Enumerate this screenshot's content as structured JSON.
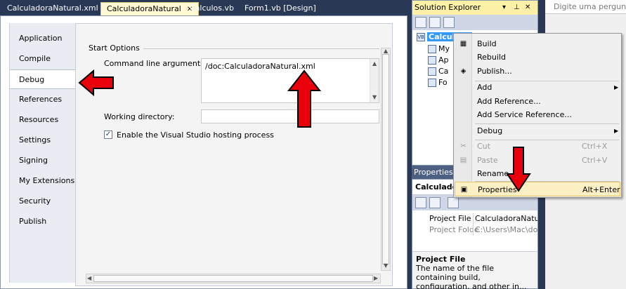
{
  "doc_tabs": [
    {
      "label": "CalculadoraNatural.xml",
      "active": false
    },
    {
      "label": "CalculadoraNatural",
      "active": true
    },
    {
      "label": "Calculos.vb",
      "active": false
    },
    {
      "label": "Form1.vb [Design]",
      "active": false
    }
  ],
  "close_glyph": "✕",
  "left_nav": {
    "items": [
      "Application",
      "Compile",
      "Debug",
      "References",
      "Resources",
      "Settings",
      "Signing",
      "My Extensions",
      "Security",
      "Publish"
    ],
    "selected": "Debug"
  },
  "start_options": {
    "section_title": "Start Options",
    "command_line_label": "Command line arguments:",
    "command_line_value": "/doc:CalculadoraNatural.xml",
    "working_dir_label": "Working directory:",
    "working_dir_value": "",
    "hosting_checkbox_label": "Enable the Visual Studio hosting process",
    "hosting_checked": true
  },
  "solution_explorer": {
    "title": "Solution Explorer",
    "pin_glyphs": [
      "▾",
      "⊥",
      "✕"
    ],
    "tree": [
      {
        "label": "Calculado",
        "icon": "vb-project-icon",
        "root": true
      },
      {
        "label": "My",
        "icon": "my-project-icon"
      },
      {
        "label": "Ap",
        "icon": "app-config-icon"
      },
      {
        "label": "Ca",
        "icon": "vb-file-icon"
      },
      {
        "label": "Fo",
        "icon": "form-file-icon"
      }
    ]
  },
  "properties": {
    "title": "Properties",
    "object": "Calculadora",
    "rows": [
      {
        "name": "Project File",
        "value": "CalculadoraNatural",
        "grey": false
      },
      {
        "name": "Project Folde",
        "value": "C:\\Users\\Mac\\doc",
        "grey": true
      }
    ],
    "desc_title": "Project File",
    "desc_text": "The name of the file containing build, configuration, and other in..."
  },
  "search": {
    "placeholder": "Digite uma pergunta"
  },
  "context_menu": {
    "items": [
      {
        "label": "Build",
        "shortcut": "",
        "icon": "build-icon",
        "submenu": false,
        "disabled": false,
        "highlight": false,
        "sep_before": false
      },
      {
        "label": "Rebuild",
        "shortcut": "",
        "icon": "",
        "submenu": false,
        "disabled": false,
        "highlight": false,
        "sep_before": false
      },
      {
        "label": "Publish...",
        "shortcut": "",
        "icon": "publish-icon",
        "submenu": false,
        "disabled": false,
        "highlight": false,
        "sep_before": false
      },
      {
        "label": "Add",
        "shortcut": "",
        "icon": "",
        "submenu": true,
        "disabled": false,
        "highlight": false,
        "sep_before": true
      },
      {
        "label": "Add Reference...",
        "shortcut": "",
        "icon": "",
        "submenu": false,
        "disabled": false,
        "highlight": false,
        "sep_before": false
      },
      {
        "label": "Add Service Reference...",
        "shortcut": "",
        "icon": "",
        "submenu": false,
        "disabled": false,
        "highlight": false,
        "sep_before": false
      },
      {
        "label": "Debug",
        "shortcut": "",
        "icon": "",
        "submenu": true,
        "disabled": false,
        "highlight": false,
        "sep_before": true
      },
      {
        "label": "Cut",
        "shortcut": "Ctrl+X",
        "icon": "cut-icon",
        "submenu": false,
        "disabled": true,
        "highlight": false,
        "sep_before": true
      },
      {
        "label": "Paste",
        "shortcut": "Ctrl+V",
        "icon": "paste-icon",
        "submenu": false,
        "disabled": true,
        "highlight": false,
        "sep_before": false
      },
      {
        "label": "Rename",
        "shortcut": "",
        "icon": "",
        "submenu": false,
        "disabled": false,
        "highlight": false,
        "sep_before": false
      },
      {
        "label": "Properties",
        "shortcut": "Alt+Enter",
        "icon": "properties-icon",
        "submenu": false,
        "disabled": false,
        "highlight": true,
        "sep_before": true
      }
    ]
  },
  "colors": {
    "chrome": "#293955",
    "active_tab": "#fff8d2",
    "se_title": "#fdf1a8",
    "annotation_red": "#e8000b",
    "selection_blue": "#3399ff"
  }
}
